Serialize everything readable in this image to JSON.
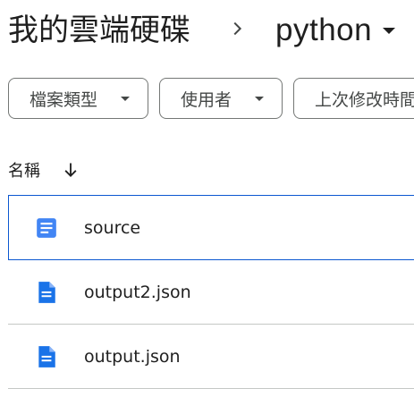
{
  "breadcrumb": {
    "root_label": "我的雲端硬碟",
    "separator_icon": "chevron-right-icon",
    "current_folder": "python",
    "current_folder_icon": "caret-down-icon"
  },
  "filters": [
    {
      "label": "檔案類型",
      "icon": "caret-down-icon"
    },
    {
      "label": "使用者",
      "icon": "caret-down-icon"
    },
    {
      "label": "上次修改時間",
      "icon": "caret-down-icon"
    }
  ],
  "column_header": {
    "name_label": "名稱",
    "sort_icon": "arrow-down-icon"
  },
  "files": [
    {
      "name": "source",
      "type": "google-doc",
      "icon": "google-docs-icon",
      "selected": true
    },
    {
      "name": "output2.json",
      "type": "file",
      "icon": "file-icon",
      "selected": false
    },
    {
      "name": "output.json",
      "type": "file",
      "icon": "file-icon",
      "selected": false
    }
  ],
  "colors": {
    "accent": "#0b57d0",
    "icon_blue": "#4285f4",
    "doc_blue": "#1a73e8",
    "border": "#747775",
    "divider": "#c4c7c5",
    "text": "#1f1f1f"
  }
}
